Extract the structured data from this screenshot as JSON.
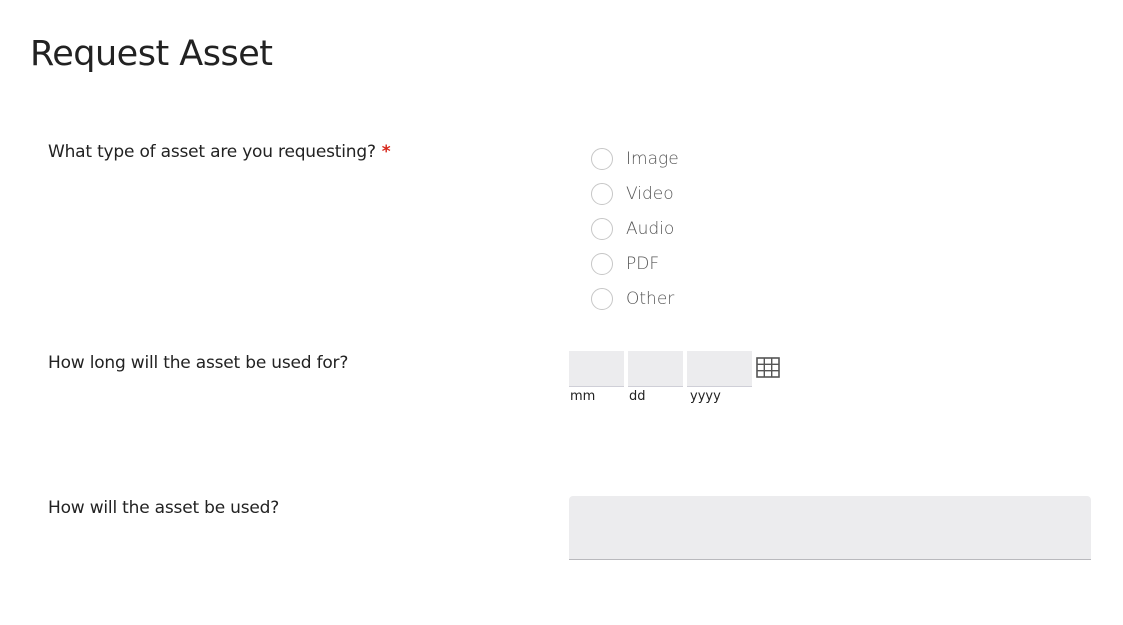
{
  "page": {
    "title": "Request Asset"
  },
  "questions": {
    "asset_type": {
      "label": "What type of asset are you requesting?",
      "required_marker": "*",
      "required": true,
      "options": [
        {
          "label": "Image",
          "selected": false
        },
        {
          "label": "Video",
          "selected": false
        },
        {
          "label": "Audio",
          "selected": false
        },
        {
          "label": "PDF",
          "selected": false
        },
        {
          "label": "Other",
          "selected": false
        }
      ]
    },
    "duration": {
      "label": "How long will the asset be used for?",
      "month": {
        "value": "",
        "hint": "mm"
      },
      "day": {
        "value": "",
        "hint": "dd"
      },
      "year": {
        "value": "",
        "hint": "yyyy"
      },
      "calendar_icon": "calendar-grid-icon"
    },
    "usage": {
      "label": "How will the asset be used?",
      "value": ""
    }
  },
  "colors": {
    "required": "#d7261a",
    "field_background": "#ececee",
    "radio_border": "#c7c7c7",
    "text": "#222222"
  }
}
